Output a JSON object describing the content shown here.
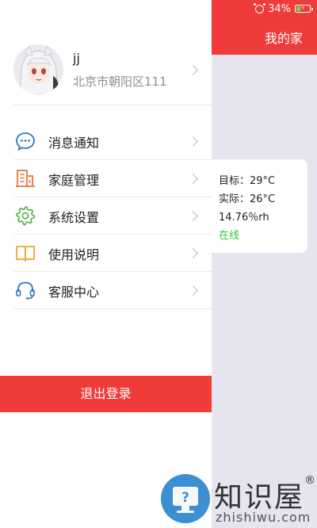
{
  "status_bar": {
    "battery": "34%",
    "battery_level": 0.34,
    "icons": [
      "alarm-icon",
      "battery-icon"
    ]
  },
  "header": {
    "title": "我的家"
  },
  "device_card": {
    "target": "目标：29°C",
    "actual": "实际：26°C",
    "humidity": "14.76％rh",
    "status": "在线",
    "status_color": "#3cc23c"
  },
  "profile": {
    "name": "jj",
    "address": "北京市朝阳区111"
  },
  "menu": {
    "items": [
      {
        "label": "消息通知",
        "icon": "message-icon",
        "color": "#2c76c8"
      },
      {
        "label": "家庭管理",
        "icon": "building-icon",
        "color": "#e8773a"
      },
      {
        "label": "系统设置",
        "icon": "gear-icon",
        "color": "#4fae44"
      },
      {
        "label": "使用说明",
        "icon": "book-icon",
        "color": "#f0a531"
      },
      {
        "label": "客服中心",
        "icon": "headset-icon",
        "color": "#2c76c8"
      }
    ]
  },
  "logout_label": "退出登录",
  "watermark": {
    "name": "知识屋",
    "url": "zhishiwu.com"
  },
  "colors": {
    "accent": "#ef3b3a",
    "background": "#e4e5ee"
  }
}
